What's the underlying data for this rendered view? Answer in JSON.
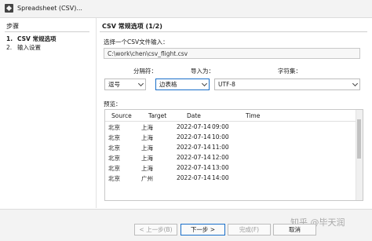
{
  "window": {
    "title": "Spreadsheet (CSV)..."
  },
  "steps": {
    "heading": "步骤",
    "items": [
      {
        "num": "1.",
        "label": "CSV 常规选项"
      },
      {
        "num": "2.",
        "label": "输入设置"
      }
    ]
  },
  "main": {
    "title": "CSV 常规选项 (1/2)",
    "select_file_label": "选择一个CSV文件输入：",
    "file_path": "C:\\work\\chen\\csv_flight.csv",
    "separator_label": "分隔符：",
    "import_as_label": "导入为：",
    "charset_label": "字符集：",
    "separator_value": "逗号",
    "import_as_value": "边表格",
    "charset_value": "UTF-8",
    "preview_label": "预览："
  },
  "preview": {
    "columns": [
      "Source",
      "Target",
      "Date",
      "Time"
    ],
    "rows": [
      [
        "北京",
        "上海",
        "2022-07-14",
        "09:00"
      ],
      [
        "北京",
        "上海",
        "2022-07-14",
        "10:00"
      ],
      [
        "北京",
        "上海",
        "2022-07-14",
        "11:00"
      ],
      [
        "北京",
        "上海",
        "2022-07-14",
        "12:00"
      ],
      [
        "北京",
        "上海",
        "2022-07-14",
        "13:00"
      ],
      [
        "北京",
        "广州",
        "2022-07-14",
        "14:00"
      ]
    ]
  },
  "buttons": {
    "back": "< 上一步(B)",
    "next": "下一步 >",
    "finish": "完成(F)",
    "cancel": "取消"
  },
  "watermark": "知乎 @毕天润"
}
